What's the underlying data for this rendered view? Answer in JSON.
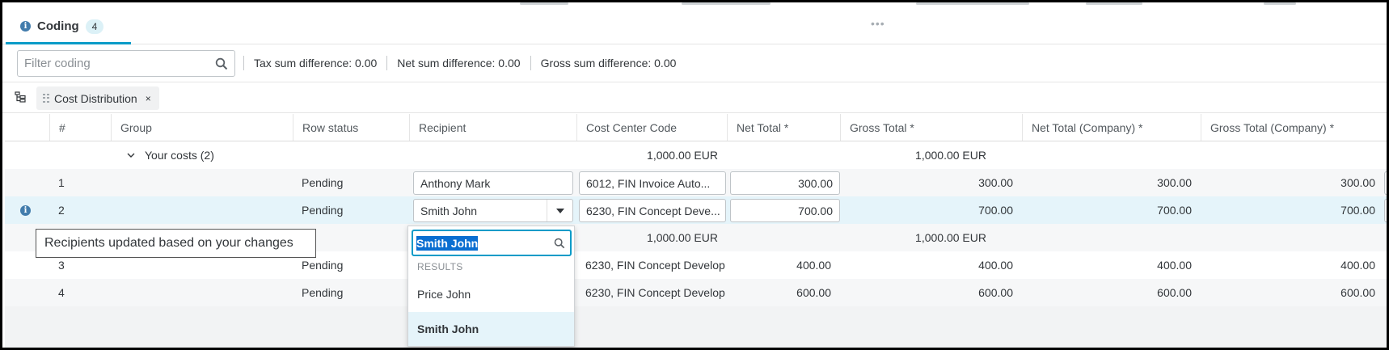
{
  "tab": {
    "label": "Coding",
    "count": "4"
  },
  "filter": {
    "placeholder": "Filter coding"
  },
  "sums": {
    "tax": "Tax sum difference: 0.00",
    "net": "Net sum difference: 0.00",
    "gross": "Gross sum difference: 0.00"
  },
  "grouping": {
    "chip_label": "Cost Distribution",
    "chip_close": "×"
  },
  "columns": [
    "#",
    "Group",
    "Row status",
    "Recipient",
    "Cost Center Code",
    "Net Total *",
    "Gross Total *",
    "Net Total (Company) *",
    "Gross Total (Company) *"
  ],
  "group1": {
    "label": "Your costs (2)",
    "net_total": "1,000.00 EUR",
    "gross_total": "1,000.00 EUR"
  },
  "group2": {
    "net_total": "1,000.00 EUR",
    "gross_total": "1,000.00 EUR"
  },
  "rows": [
    {
      "num": "1",
      "status": "Pending",
      "recipient": "Anthony Mark",
      "cost_center": "6012, FIN Invoice Auto...",
      "net": "300.00",
      "gross": "300.00",
      "net_company": "300.00",
      "gross_company": "300.00"
    },
    {
      "num": "2",
      "status": "Pending",
      "recipient": "Smith John",
      "cost_center": "6230, FIN Concept Deve...",
      "net": "700.00",
      "gross": "700.00",
      "net_company": "700.00",
      "gross_company": "700.00"
    },
    {
      "num": "3",
      "status": "Pending",
      "recipient": "",
      "cost_center": "6230, FIN Concept Develop",
      "net": "400.00",
      "gross": "400.00",
      "net_company": "400.00",
      "gross_company": "400.00"
    },
    {
      "num": "4",
      "status": "Pending",
      "recipient": "",
      "cost_center": "6230, FIN Concept Develop",
      "net": "600.00",
      "gross": "600.00",
      "net_company": "600.00",
      "gross_company": "600.00"
    }
  ],
  "tooltip": "Recipients updated based on your changes",
  "popup": {
    "search_value": "Smith John",
    "results_header": "RESULTS",
    "options": [
      "Price John",
      "Smith John"
    ]
  },
  "colors": {
    "accent": "#0a9bc8",
    "selection": "#0a6ed1",
    "selected_row": "#e5f4fa",
    "info": "#427cac"
  },
  "icons": {
    "tab_info": "info-icon",
    "row_info": "info-icon",
    "search": "search-icon",
    "tree": "tree-settings-icon",
    "dropdown": "caret-down-icon",
    "expand": "chevron-down-icon"
  }
}
